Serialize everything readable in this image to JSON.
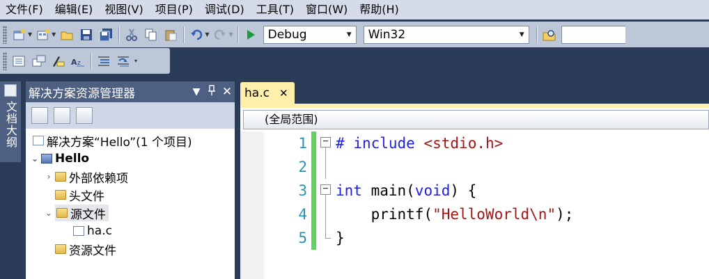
{
  "menu": {
    "items": [
      "文件(F)",
      "编辑(E)",
      "视图(V)",
      "项目(P)",
      "调试(D)",
      "工具(T)",
      "窗口(W)",
      "帮助(H)"
    ]
  },
  "toolbar": {
    "config_combo": "Debug",
    "platform_combo": "Win32",
    "find_value": ""
  },
  "left_tab": {
    "label": "文档大纲"
  },
  "solution_explorer": {
    "title": "解决方案资源管理器",
    "tree": {
      "solution": "解决方案“Hello”(1 个项目)",
      "project": "Hello",
      "external_deps": "外部依赖项",
      "header_files": "头文件",
      "source_files": "源文件",
      "file": "ha.c",
      "resource_files": "资源文件"
    }
  },
  "editor": {
    "tab_label": "ha.c",
    "tab_close": "✕",
    "scope": "(全局范围)",
    "line_numbers": [
      "1",
      "2",
      "3",
      "4",
      "5"
    ],
    "code": {
      "l1_kw1": "#",
      "l1_kw2": "include",
      "l1_rest": "<stdio.h>",
      "l3_kw1": "int",
      "l3_mid": " main(",
      "l3_kw2": "void",
      "l3_end": ") {",
      "l4_pre": "    printf(",
      "l4_str": "\"HelloWorld\\n\"",
      "l4_end": ");",
      "l5": "}"
    }
  },
  "colors": {
    "ide_background": "#2b3c59",
    "menubar": "#d6dbe9",
    "active_tab": "#fff1ac",
    "keyword": "#2020e0",
    "string": "#a31515",
    "line_number": "#2b91af",
    "change_bar": "#5fd35f"
  }
}
